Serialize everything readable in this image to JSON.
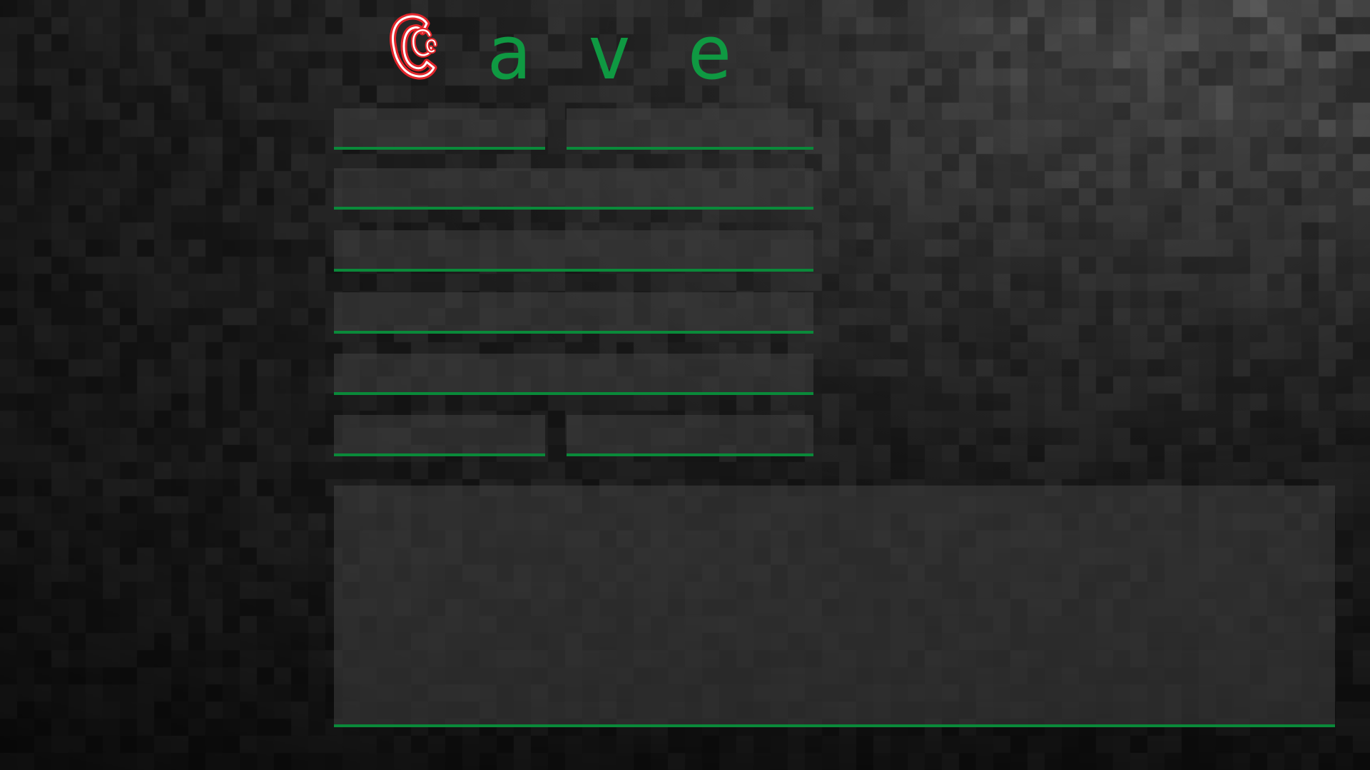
{
  "app": {
    "logo_word": "ave",
    "brand_color": "#0f9942",
    "accent_red": "#e3262b",
    "logo_icon": "cave-c-logo-icon"
  },
  "form": {
    "first_name": {
      "value": "",
      "placeholder": ""
    },
    "last_name": {
      "value": "",
      "placeholder": ""
    },
    "row2": {
      "value": "",
      "placeholder": ""
    },
    "row3": {
      "value": "",
      "placeholder": ""
    },
    "row4": {
      "value": "",
      "placeholder": ""
    },
    "row5": {
      "value": "",
      "placeholder": ""
    },
    "row6_left": {
      "value": "",
      "placeholder": ""
    },
    "row6_right": {
      "value": "",
      "placeholder": ""
    },
    "message": {
      "value": "",
      "placeholder": ""
    }
  }
}
